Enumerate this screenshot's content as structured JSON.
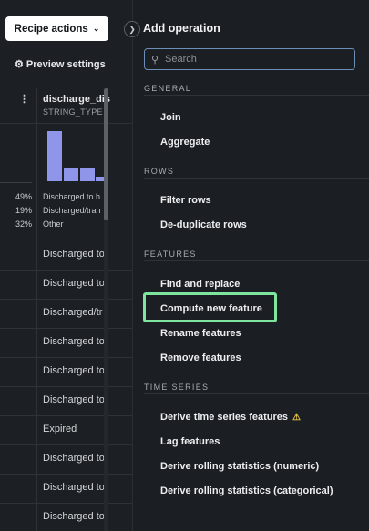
{
  "toolbar": {
    "recipe_actions": "Recipe actions",
    "preview_settings": "Preview settings"
  },
  "table": {
    "column": {
      "name": "discharge_dis",
      "type": "STRING_TYPE"
    },
    "histogram": {
      "bars": [
        0.66,
        0.18,
        0.18,
        0.06
      ],
      "legend": [
        {
          "pct": "49%",
          "label": "Discharged to h"
        },
        {
          "pct": "19%",
          "label": "Discharged/tran"
        },
        {
          "pct": "32%",
          "label": "Other"
        }
      ]
    },
    "rows": [
      "Discharged to",
      "Discharged to",
      "Discharged/tr",
      "Discharged to",
      "Discharged to",
      "Discharged to",
      "Expired",
      "Discharged to",
      "Discharged to",
      "Discharged to"
    ]
  },
  "panel": {
    "title": "Add operation",
    "search_placeholder": "Search",
    "sections": [
      {
        "title": "GENERAL",
        "items": [
          "Join",
          "Aggregate"
        ]
      },
      {
        "title": "ROWS",
        "items": [
          "Filter rows",
          "De-duplicate rows"
        ]
      },
      {
        "title": "FEATURES",
        "items": [
          "Find and replace",
          "Compute new feature",
          "Rename features",
          "Remove features"
        ]
      },
      {
        "title": "TIME SERIES",
        "items": [
          "Derive time series features",
          "Lag features",
          "Derive rolling statistics (numeric)",
          "Derive rolling statistics (categorical)"
        ]
      }
    ],
    "highlighted_item": "Compute new feature"
  },
  "colors": {
    "highlight": "#7ee59e",
    "histogram_bar": "#8f95e8",
    "warning": "#e8c547"
  }
}
